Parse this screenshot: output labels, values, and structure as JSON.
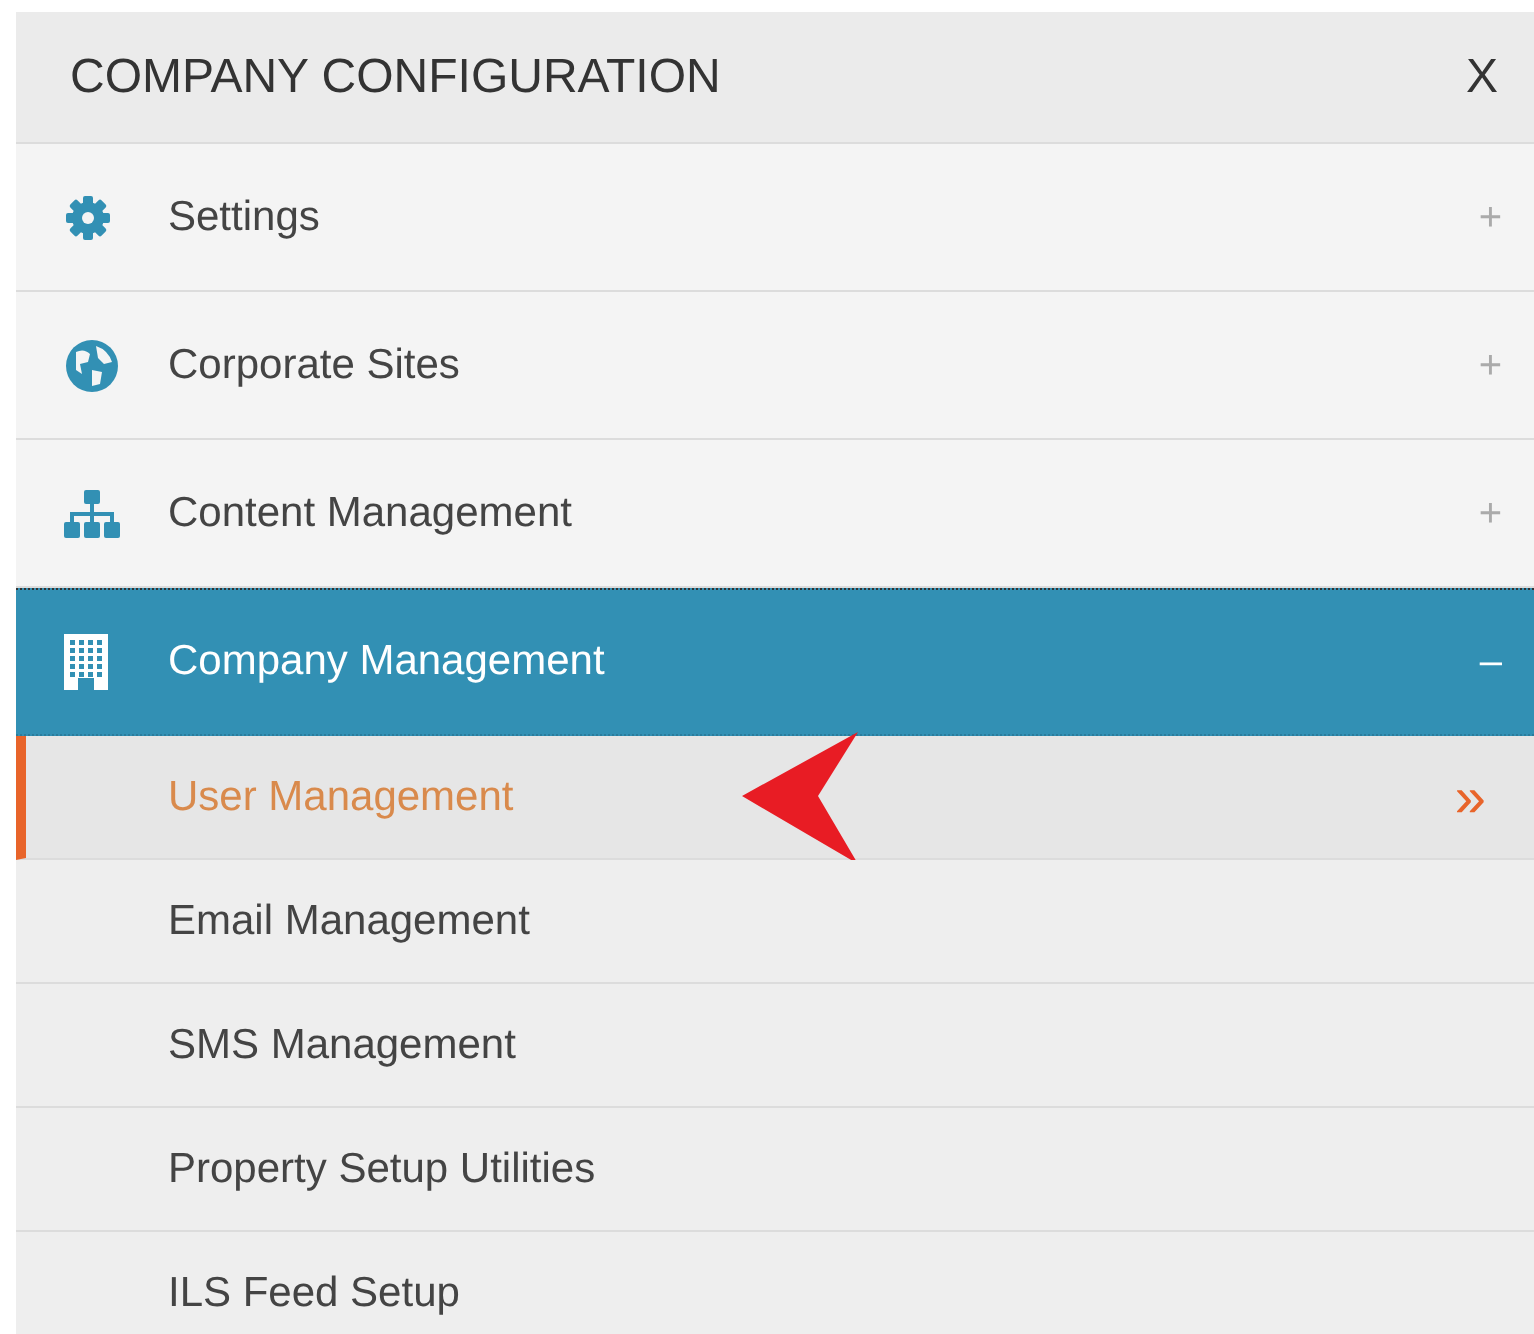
{
  "panel": {
    "title": "COMPANY CONFIGURATION",
    "close": "X"
  },
  "sections": [
    {
      "label": "Settings",
      "expanded": false,
      "toggle": "+"
    },
    {
      "label": "Corporate Sites",
      "expanded": false,
      "toggle": "+"
    },
    {
      "label": "Content Management",
      "expanded": false,
      "toggle": "+"
    },
    {
      "label": "Company Management",
      "expanded": true,
      "toggle": "–",
      "children": [
        {
          "label": "User Management",
          "selected": true,
          "indicator": "»"
        },
        {
          "label": "Email Management",
          "selected": false
        },
        {
          "label": "SMS Management",
          "selected": false
        },
        {
          "label": "Property Setup Utilities",
          "selected": false
        },
        {
          "label": "ILS Feed Setup",
          "selected": false
        }
      ]
    }
  ]
}
